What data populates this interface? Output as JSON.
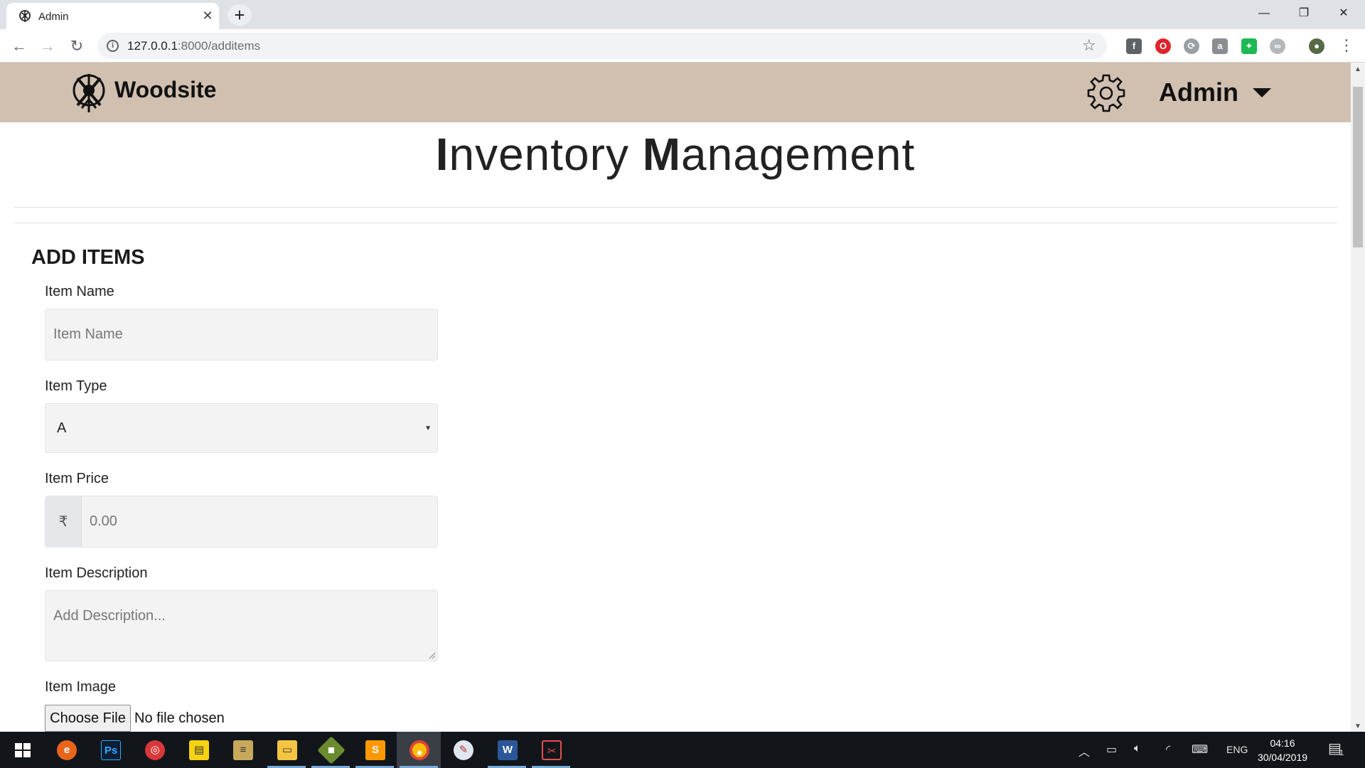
{
  "browser": {
    "tab_title": "Admin",
    "url_host": "127.0.0.1",
    "url_path": ":8000/additems"
  },
  "site": {
    "brand": "Woodsite",
    "user_menu": "Admin"
  },
  "page": {
    "heading_first_initial": "I",
    "heading_first_rest": "nventory ",
    "heading_second_initial": "M",
    "heading_second_rest": "anagement"
  },
  "form": {
    "section_title": "ADD ITEMS",
    "item_name": {
      "label": "Item Name",
      "placeholder": "Item Name"
    },
    "item_type": {
      "label": "Item Type",
      "selected": "A"
    },
    "item_price": {
      "label": "Item Price",
      "currency_symbol": "₹",
      "placeholder": "0.00"
    },
    "item_description": {
      "label": "Item Description",
      "placeholder": "Add Description..."
    },
    "item_image": {
      "label": "Item Image",
      "button": "Choose File",
      "status": "No file chosen"
    }
  },
  "taskbar": {
    "apps": [
      "start",
      "edge",
      "photoshop",
      "browser",
      "sticky-notes",
      "notepad",
      "file-explorer",
      "git",
      "sublime-text",
      "chrome",
      "paint",
      "word",
      "snipping-tool"
    ],
    "language": "ENG",
    "time": "04:16",
    "date": "30/04/2019",
    "notification_count": "1"
  }
}
